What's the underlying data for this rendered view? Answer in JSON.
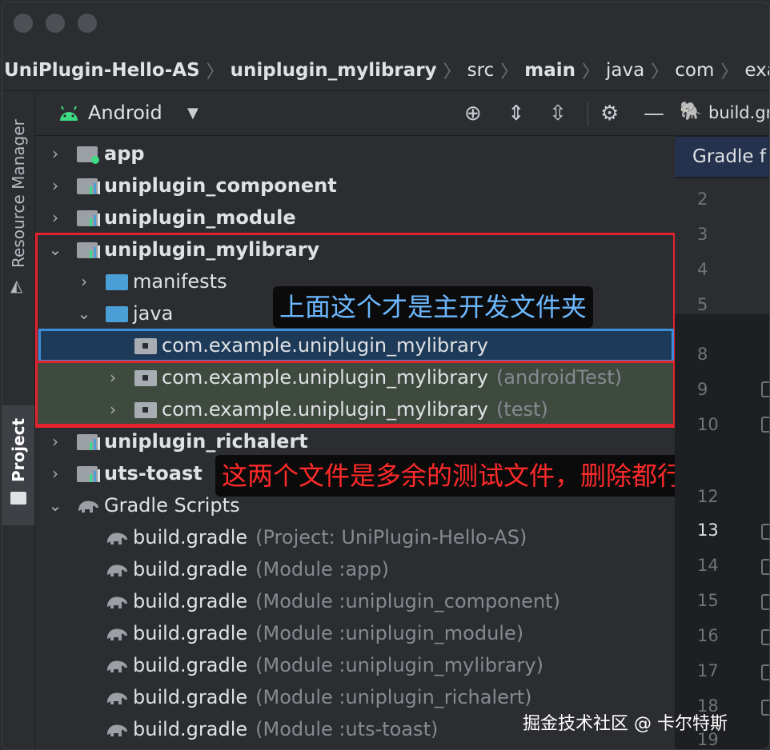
{
  "breadcrumb": {
    "items": [
      {
        "label": "UniPlugin-Hello-AS",
        "bold": true
      },
      {
        "label": "uniplugin_mylibrary",
        "bold": true
      },
      {
        "label": "src",
        "bold": false
      },
      {
        "label": "main",
        "bold": true
      },
      {
        "label": "java",
        "bold": false
      },
      {
        "label": "com",
        "bold": false
      },
      {
        "label": "example",
        "bold": false
      }
    ]
  },
  "sidebar": {
    "resource_manager": "Resource Manager",
    "project": "Project"
  },
  "panel": {
    "view_mode": "Android"
  },
  "tree": {
    "app": "app",
    "uniplugin_component": "uniplugin_component",
    "uniplugin_module": "uniplugin_module",
    "uniplugin_mylibrary": "uniplugin_mylibrary",
    "manifests": "manifests",
    "java": "java",
    "pkg_main": "com.example.uniplugin_mylibrary",
    "pkg_android_test": "com.example.uniplugin_mylibrary",
    "pkg_android_test_suffix": "(androidTest)",
    "pkg_test": "com.example.uniplugin_mylibrary",
    "pkg_test_suffix": "(test)",
    "uniplugin_richalert": "uniplugin_richalert",
    "uts_toast": "uts-toast",
    "gradle_scripts": "Gradle Scripts",
    "gradle_files": [
      {
        "name": "build.gradle",
        "detail": "(Project: UniPlugin-Hello-AS)"
      },
      {
        "name": "build.gradle",
        "detail": "(Module :app)"
      },
      {
        "name": "build.gradle",
        "detail": "(Module :uniplugin_component)"
      },
      {
        "name": "build.gradle",
        "detail": "(Module :uniplugin_module)"
      },
      {
        "name": "build.gradle",
        "detail": "(Module :uniplugin_mylibrary)"
      },
      {
        "name": "build.gradle",
        "detail": "(Module :uniplugin_richalert)"
      },
      {
        "name": "build.gradle",
        "detail": "(Module :uts-toast)"
      }
    ]
  },
  "annotations": {
    "main_note": "上面这个才是主开发文件夹",
    "test_note": "这两个文件是多余的测试文件，删除都行"
  },
  "editor": {
    "tab_label": "build.gr",
    "banner": "Gradle f",
    "line_numbers": [
      "2",
      "3",
      "4",
      "5",
      "8",
      "9",
      "10",
      "12",
      "13",
      "14",
      "15",
      "16",
      "17",
      "18",
      "19"
    ]
  },
  "watermark": "掘金技术社区 @ 卡尔特斯",
  "colors": {
    "background": "#2b2d30",
    "selection": "#1d3b58",
    "annotation_red": "#e5232e",
    "annotation_blue": "#3d8ed8",
    "main_note_text": "#6cb8ff",
    "test_note_text": "#ff2a2a",
    "android_green": "#3ddc84"
  }
}
